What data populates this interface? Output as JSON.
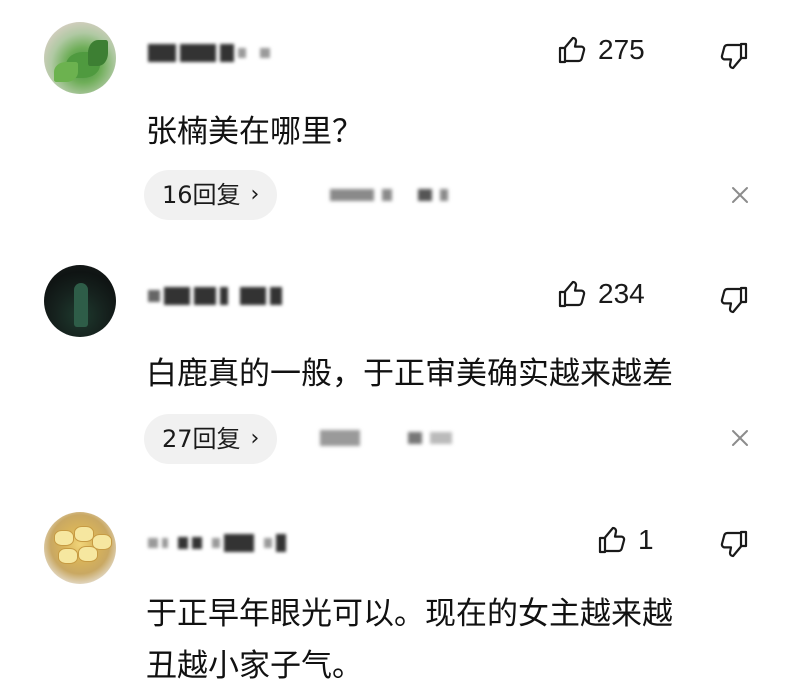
{
  "comments": [
    {
      "avatar": "vegetable-photo-avatar",
      "likes": "275",
      "text": "张楠美在哪里？",
      "replies_label": "16回复",
      "reply_chevron": "›",
      "icons": {
        "like": "thumbs-up-icon",
        "dislike": "thumbs-down-icon",
        "close": "close-icon"
      }
    },
    {
      "avatar": "dark-figure-avatar",
      "likes": "234",
      "text": "白鹿真的一般，于正审美确实越来越差",
      "replies_label": "27回复",
      "reply_chevron": "›",
      "icons": {
        "like": "thumbs-up-icon",
        "dislike": "thumbs-down-icon",
        "close": "close-icon"
      }
    },
    {
      "avatar": "cakes-photo-avatar",
      "likes": "1",
      "text": "于正早年眼光可以。现在的女主越来越\n丑越小家子气。",
      "icons": {
        "like": "thumbs-up-icon",
        "dislike": "thumbs-down-icon"
      }
    }
  ],
  "colors": {
    "background": "#ffffff",
    "text": "#111111",
    "pill_background": "#f1f1f1",
    "icon_gray": "#555555"
  }
}
